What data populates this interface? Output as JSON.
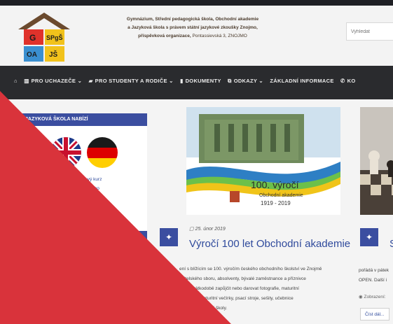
{
  "header": {
    "school_line1": "Gymnázium, Střední pedagogická škola, Obchodní akademie",
    "school_line2": "a Jazyková škola s právem státní jazykové zkoušky Znojmo,",
    "school_line3": "příspěvková organizace,",
    "school_address": "Pontassievská 3, ZNOJMO",
    "logo_top_left": "G",
    "logo_top_right": "SPgŠ",
    "logo_bottom_left": "OA",
    "logo_bottom_right": "JŠ"
  },
  "search": {
    "placeholder": "Vyhledat"
  },
  "nav": {
    "items": [
      {
        "label": "PRO UCHAZEČE ⌄",
        "icon": "chart-icon"
      },
      {
        "label": "PRO STUDENTY A RODIČE ⌄",
        "icon": "graduation-cap-icon"
      },
      {
        "label": "DOKUMENTY",
        "icon": "book-icon"
      },
      {
        "label": "ODKAZY ⌄",
        "icon": "external-link-icon"
      },
      {
        "label": "ZÁKLADNÍ INFORMACE",
        "icon": ""
      },
      {
        "label": "KO",
        "icon": "phone-icon"
      }
    ]
  },
  "sidebar": {
    "title": "JAZYKOVÁ ŠKOLA NABÍZÍ",
    "lang_line1": "kový kurz",
    "lang_line2": "élického"
  },
  "post1": {
    "image_caption_title": "100. výročí",
    "image_caption_sub": "Obchodní akademie",
    "image_caption_years": "1919 - 2019",
    "date": "25. únor 2019",
    "title": "Výročí 100 let Obchodní akademie",
    "excerpt_line1": "ení s blížícím se 100. výročím českého obchodního školství ve Znojmě",
    "excerpt_line2": "učitelského sboru, absolventy, bývalé zaměstnance a příznivce",
    "excerpt_line3": "mohli krátkodobě zapůjčit nebo darovat fotografie, maturitní",
    "excerpt_line4": "na ples či maturitní večírky, psací stroje, sešity, učebnice",
    "excerpt_line5": "vztahem k historii školy."
  },
  "post2": {
    "title_initial": "S",
    "excerpt_line1": "pořádá v pátek",
    "excerpt_line2": "OPEN. Další i",
    "views": "Zobrazení:",
    "more": "Číst dál..."
  },
  "colors": {
    "accent": "#3b4ea0",
    "nav_bg": "#2a2b2e",
    "overlay_red": "#d9333b"
  }
}
